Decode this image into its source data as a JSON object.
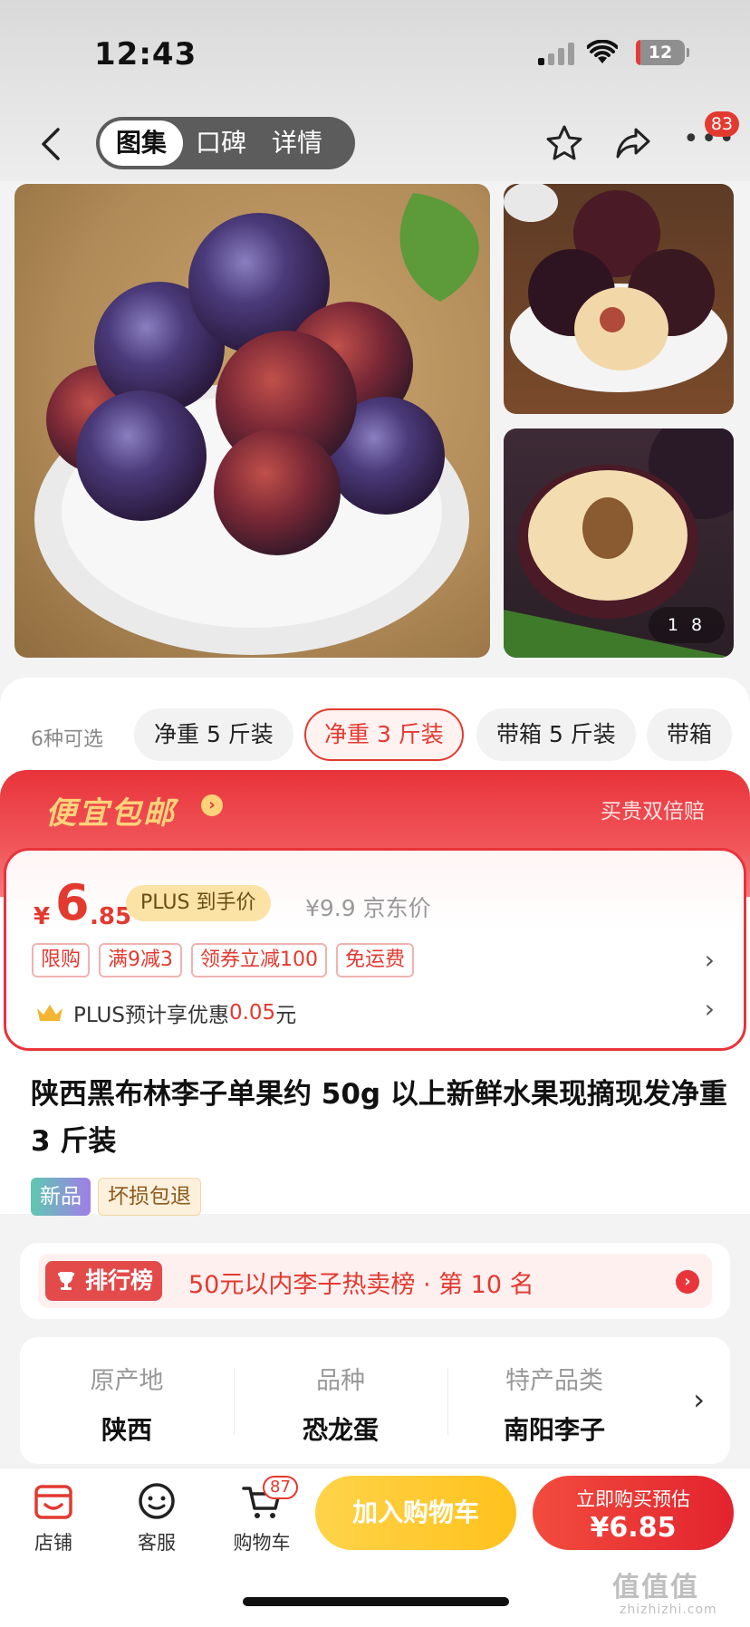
{
  "status_bar": {
    "time": "12:43",
    "battery": "12"
  },
  "nav": {
    "tabs": [
      {
        "label": "图集"
      },
      {
        "label": "口碑"
      },
      {
        "label": "详情"
      }
    ],
    "more_badge": "83"
  },
  "gallery": {
    "counter_current": "1",
    "counter_total": "8"
  },
  "specs": {
    "count_label": "6种可选",
    "options": [
      "净重 5 斤装",
      "净重 3 斤装",
      "带箱 5 斤装",
      "带箱"
    ],
    "selected_index": 1
  },
  "promo": {
    "title": "便宜包邮",
    "right_text": "买贵双倍赔",
    "price_symbol": "¥",
    "price_integer": "6",
    "price_decimal": ".85",
    "plus_pill": "PLUS 到手价",
    "original_price": "¥9.9 京东价",
    "tags": [
      "限购",
      "满9减3",
      "领券立减100",
      "免运费"
    ],
    "plus_text": "PLUS预计享优惠",
    "plus_amount": "0.05",
    "plus_unit": "元"
  },
  "product": {
    "title": "陕西黑布林李子单果约 50g 以上新鲜水果现摘现发净重 3 斤装",
    "badge_new": "新品",
    "badge_return": "坏损包退"
  },
  "ranking": {
    "label": "排行榜",
    "text": "50元以内李子热卖榜 · 第 10 名"
  },
  "attributes": [
    {
      "key": "原产地",
      "value": "陕西"
    },
    {
      "key": "品种",
      "value": "恐龙蛋"
    },
    {
      "key": "特产品类",
      "value": "南阳李子"
    }
  ],
  "bottom_bar": {
    "store_label": "店铺",
    "service_label": "客服",
    "cart_label": "购物车",
    "cart_badge": "87",
    "add_cart_label": "加入购物车",
    "buy_line1": "立即购买预估",
    "buy_line2": "¥6.85"
  },
  "watermark": {
    "text": "值值值",
    "sub": "zhizhizhi.com"
  },
  "colors": {
    "accent": "#e33a30",
    "gold": "#ffd27a",
    "cart_yellow": "#ffc21c"
  }
}
